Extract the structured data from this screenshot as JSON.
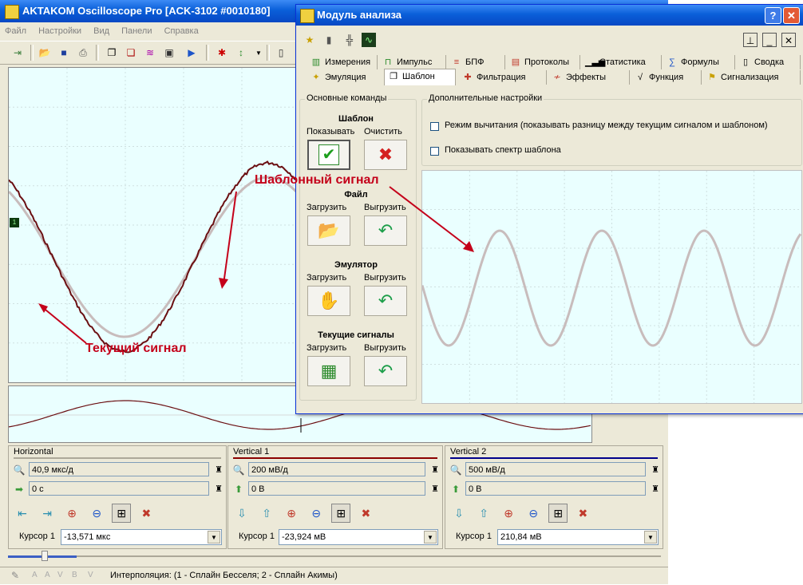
{
  "main": {
    "title": "AKTAKOM Oscilloscope Pro [ACK-3102 #0010180]",
    "menu": [
      "Файл",
      "Настройки",
      "Вид",
      "Панели",
      "Справка"
    ],
    "channel_marker": "1"
  },
  "panels": {
    "horizontal": {
      "title": "Horizontal",
      "timebase": "40,9 мкс/д",
      "offset": "0 с",
      "cursor_label": "Курсор 1",
      "cursor_value": "-13,571 мкс",
      "rule_color": "#aca899"
    },
    "vertical1": {
      "title": "Vertical 1",
      "scale": "200 мВ/д",
      "offset": "0 В",
      "cursor_label": "Курсор 1",
      "cursor_value": "-23,924 мВ",
      "rule_color": "#8b0000"
    },
    "vertical2": {
      "title": "Vertical 2",
      "scale": "500 мВ/д",
      "offset": "0 В",
      "cursor_label": "Курсор 1",
      "cursor_value": "210,84 мВ",
      "rule_color": "#00008b"
    }
  },
  "status": {
    "indicators": [
      "A",
      "A",
      "V",
      "B",
      "V"
    ],
    "text": "Интерполяция: (1 - Сплайн Бесселя; 2 - Сплайн Акимы)"
  },
  "analysis": {
    "title": "Модуль анализа",
    "tabs_row1": [
      "Измерения",
      "Импульс",
      "БПФ",
      "Протоколы",
      "Статистика",
      "Формулы",
      "Сводка"
    ],
    "tabs_row2": [
      "Эмуляция",
      "Шаблон",
      "Фильтрация",
      "Эффекты",
      "Функция",
      "Сигнализация"
    ],
    "basic_commands": {
      "title": "Основные команды",
      "template_section": "Шаблон",
      "show": "Показывать",
      "clear": "Очистить",
      "file_section": "Файл",
      "load": "Загрузить",
      "unload": "Выгрузить",
      "emulator_section": "Эмулятор",
      "current_section": "Текущие сигналы"
    },
    "additional": {
      "title": "Дополнительные настройки",
      "subtract_mode": "Режим вычитания (показывать разницу между текущим сигналом и шаблоном)",
      "show_spectrum": "Показывать спектр шаблона"
    }
  },
  "annotations": {
    "template_signal": "Шаблонный сигнал",
    "current_signal": "Текущий сигнал"
  },
  "colors": {
    "current_signal": "#6b0f12",
    "template_signal": "#c8bcbc",
    "screen_bg": "#eaffff",
    "annotation": "#c4001a"
  }
}
